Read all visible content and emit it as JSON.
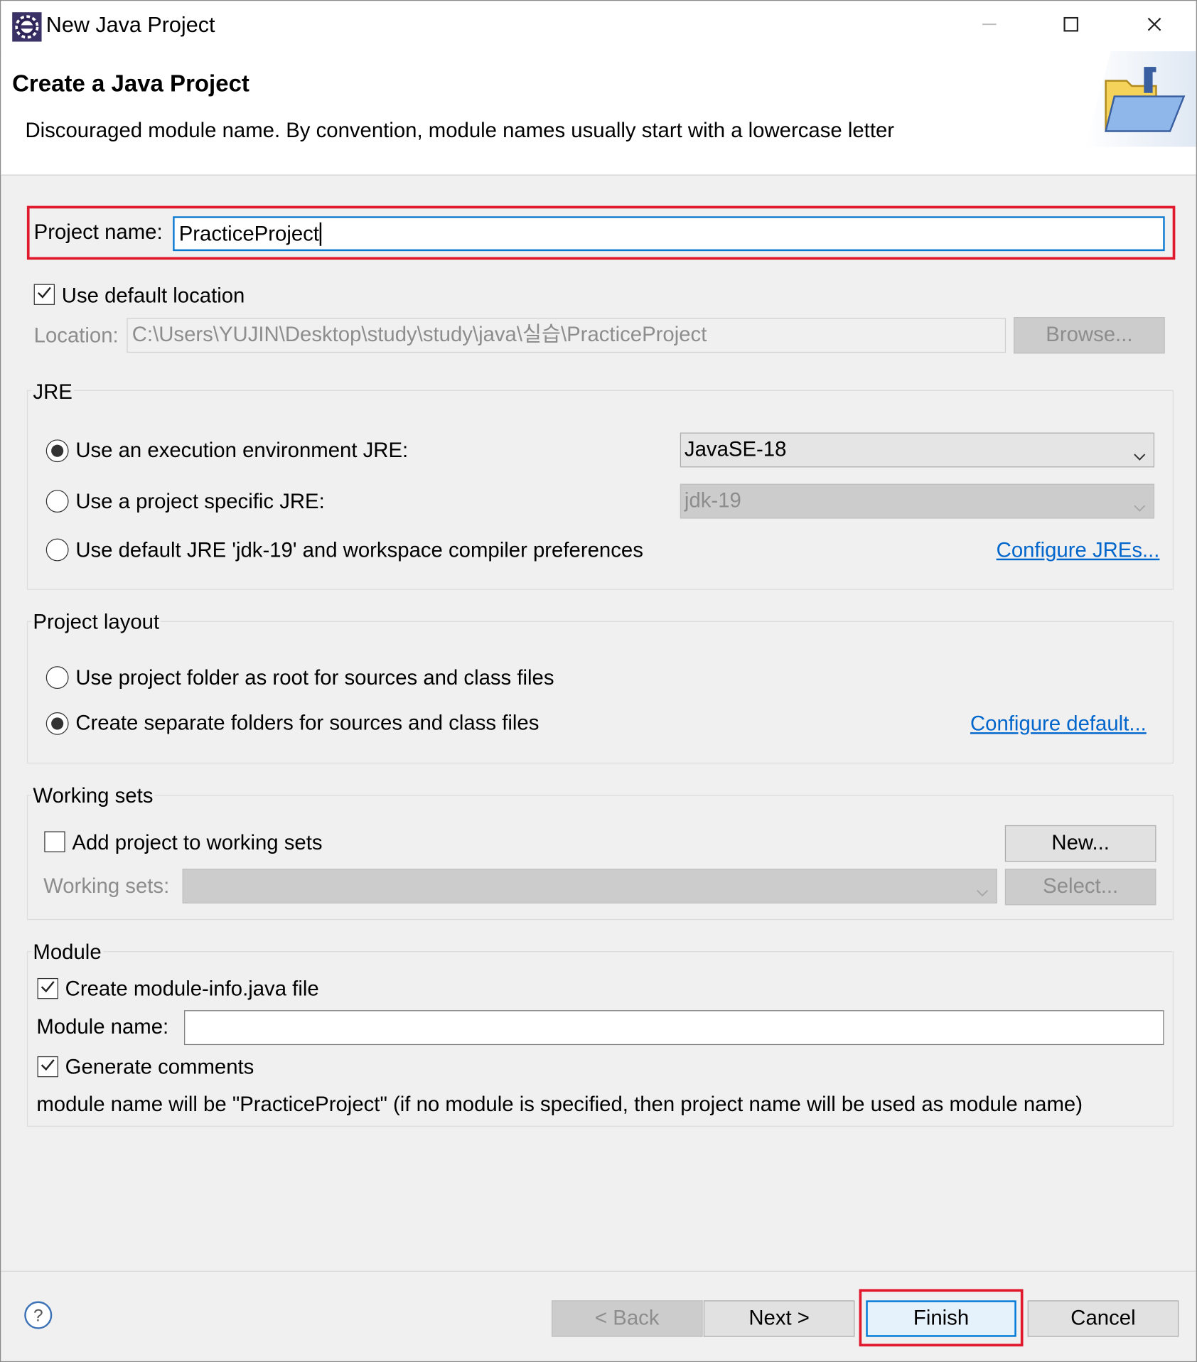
{
  "window": {
    "title": "New Java Project"
  },
  "header": {
    "title": "Create a Java Project",
    "message": "Discouraged module name. By convention, module names usually start with a lowercase letter"
  },
  "project": {
    "name_label": "Project name:",
    "name_value": "PracticeProject"
  },
  "location": {
    "use_default_label": "Use default location",
    "use_default_checked": true,
    "label": "Location:",
    "value": "C:\\Users\\YUJIN\\Desktop\\study\\study\\java\\실습\\PracticeProject",
    "browse_label": "Browse..."
  },
  "jre": {
    "group_title": "JRE",
    "option_exec_env": "Use an execution environment JRE:",
    "exec_env_value": "JavaSE-18",
    "option_project_specific": "Use a project specific JRE:",
    "project_specific_value": "jdk-19",
    "option_default": "Use default JRE 'jdk-19' and workspace compiler preferences",
    "configure_link": "Configure JREs...",
    "selected": "exec_env"
  },
  "layout": {
    "group_title": "Project layout",
    "option_root": "Use project folder as root for sources and class files",
    "option_separate": "Create separate folders for sources and class files",
    "configure_link": "Configure default...",
    "selected": "separate"
  },
  "working_sets": {
    "group_title": "Working sets",
    "add_label": "Add project to working sets",
    "add_checked": false,
    "new_label": "New...",
    "sets_label": "Working sets:",
    "select_label": "Select..."
  },
  "module": {
    "group_title": "Module",
    "create_label": "Create module-info.java file",
    "create_checked": true,
    "name_label": "Module name:",
    "name_value": "",
    "generate_comments_label": "Generate comments",
    "generate_comments_checked": true,
    "info_text": "module name will be \"PracticeProject\"  (if no module is specified, then project name will be used as module name)"
  },
  "footer": {
    "back_label": "< Back",
    "next_label": "Next >",
    "finish_label": "Finish",
    "cancel_label": "Cancel"
  },
  "icons": [
    "eclipse-icon",
    "minimize-icon",
    "maximize-icon",
    "close-icon",
    "java-project-folder-icon",
    "help-icon",
    "checkmark-icon",
    "chevron-down-icon"
  ],
  "colors": {
    "highlight_box": "#e0192c",
    "link": "#0066cc",
    "focus": "#0b78d0"
  }
}
